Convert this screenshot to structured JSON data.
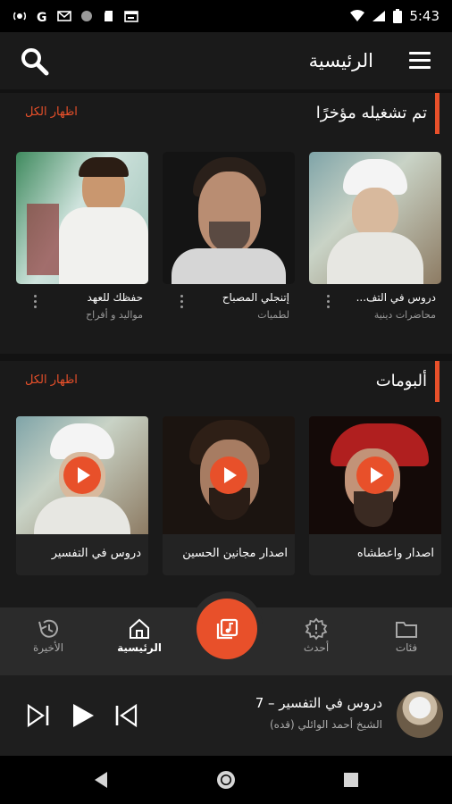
{
  "status": {
    "time": "5:43",
    "left_icons": [
      "radio-icon",
      "g-icon",
      "gmail-icon",
      "circle-icon",
      "sd-icon",
      "calendar-icon"
    ],
    "right_icons": [
      "wifi-icon",
      "signal-icon",
      "battery-icon"
    ]
  },
  "appbar": {
    "title": "الرئيسية"
  },
  "recent": {
    "title": "تم تشغيله مؤخرًا",
    "see_all": "اظهار الكل",
    "items": [
      {
        "name": "دروس في التف...",
        "sub": "محاضرات دينية"
      },
      {
        "name": "إتنجلي المصباح",
        "sub": "لطميات"
      },
      {
        "name": "حفظك للعهد",
        "sub": "مواليد و أفراح"
      }
    ]
  },
  "albums": {
    "title": "ألبومات",
    "see_all": "اظهار الكل",
    "items": [
      {
        "name": "اصدار واعطشاه"
      },
      {
        "name": "اصدار مجانين الحسين"
      },
      {
        "name": "دروس في التفسير"
      }
    ]
  },
  "nav": {
    "items": [
      {
        "label": "فئات",
        "icon": "folder-icon"
      },
      {
        "label": "أحدث",
        "icon": "new-icon"
      },
      {
        "label": "الرئيسية",
        "icon": "home-icon"
      },
      {
        "label": "الأخيرة",
        "icon": "history-icon"
      }
    ]
  },
  "player": {
    "title": "دروس في التفسير – 7",
    "artist": "الشيخ أحمد الوائلي (قده)"
  },
  "colors": {
    "accent": "#e8502a",
    "background": "#121212",
    "surface": "#1a1a1a"
  }
}
